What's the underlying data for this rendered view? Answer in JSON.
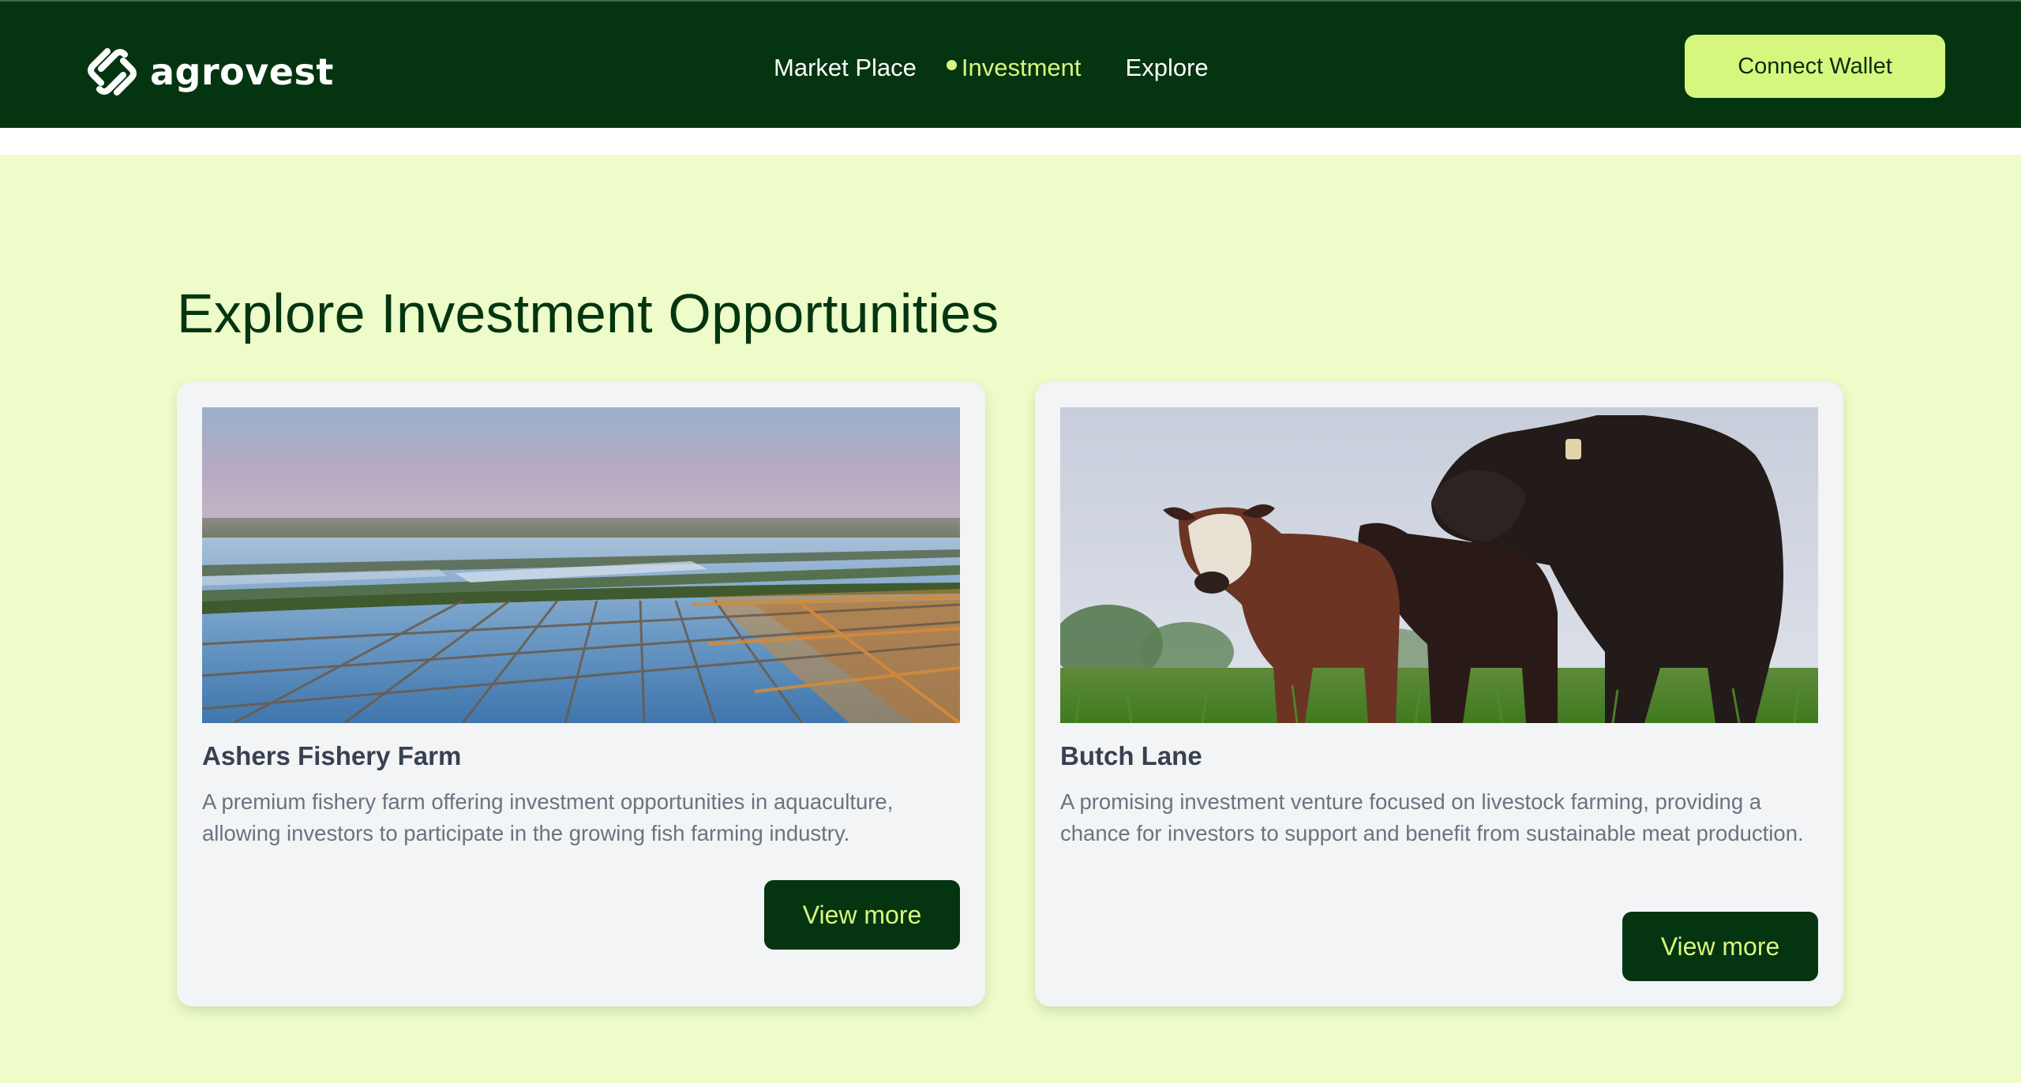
{
  "header": {
    "brand_name": "agrovest",
    "nav": [
      {
        "label": "Market Place",
        "active": false
      },
      {
        "label": "Investment",
        "active": true
      },
      {
        "label": "Explore",
        "active": false
      }
    ],
    "connect_label": "Connect Wallet"
  },
  "main": {
    "title": "Explore Investment Opportunities",
    "cards": [
      {
        "title": "Ashers Fishery Farm",
        "description": "A premium fishery farm offering investment opportunities in aquaculture, allowing investors to participate in the growing fish farming industry.",
        "button": "View more"
      },
      {
        "title": "Butch Lane",
        "description": "A promising investment venture focused on livestock farming, providing a chance for investors to support and benefit from sustainable meat production.",
        "button": "View more"
      }
    ]
  },
  "colors": {
    "header_bg": "#053510",
    "page_bg": "#edfcc8",
    "accent": "#d6f77d",
    "active_nav": "#d8f77f",
    "card_bg": "#f3f4f6"
  },
  "icons": {
    "logo": "agrovest-logo-icon",
    "nav_active_indicator": "dot-icon"
  }
}
